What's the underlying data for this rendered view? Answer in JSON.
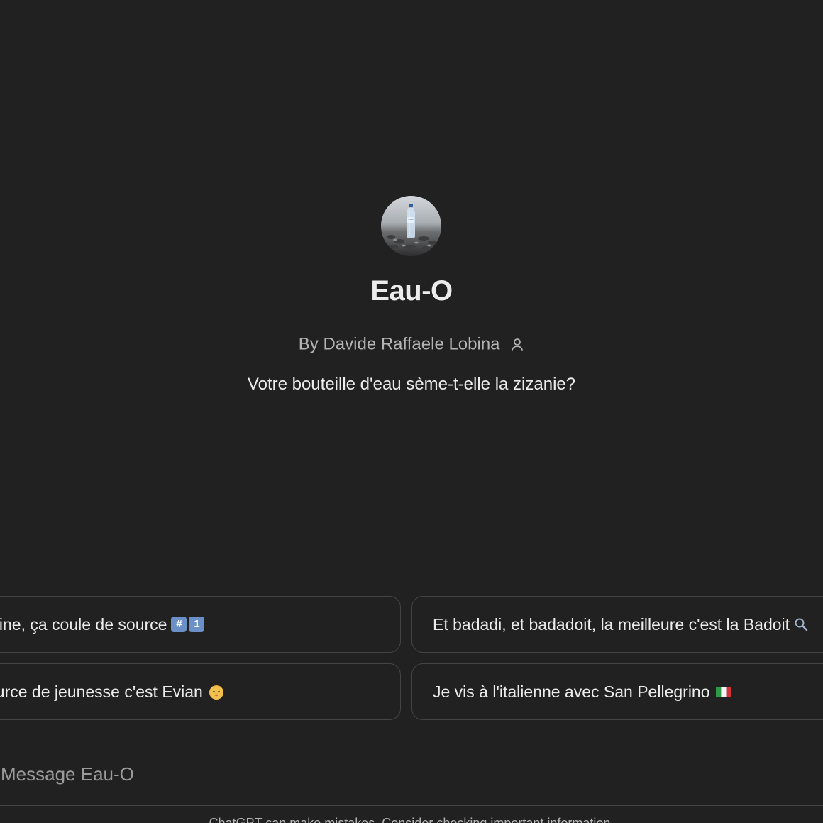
{
  "gpt": {
    "name": "Eau-O",
    "byline": "By Davide Raffaele Lobina",
    "description": "Votre bouteille d'eau sème-t-elle la zizanie?"
  },
  "starters": [
    {
      "text": "aline, ça coule de source",
      "emoji_keys": [
        "#",
        "1"
      ]
    },
    {
      "text": "Et badadi, et badadoit, la meilleure c'est la Badoit"
    },
    {
      "text": "ource de jeunesse c'est Evian"
    },
    {
      "text": "Je vis à l'italienne avec San Pellegrino"
    }
  ],
  "composer": {
    "placeholder": "Message Eau-O"
  },
  "footer": {
    "note": "ChatGPT can make mistakes. Consider checking important information."
  },
  "icons": {
    "author": "person-icon",
    "starter1": "keycap-hash-one-icon",
    "starter2": "magnifier-icon",
    "starter3": "baby-face-icon",
    "starter4": "italy-flag-icon"
  },
  "colors": {
    "background": "#212121",
    "border": "#444444",
    "text": "#ececec",
    "muted": "#b4b4b4"
  }
}
